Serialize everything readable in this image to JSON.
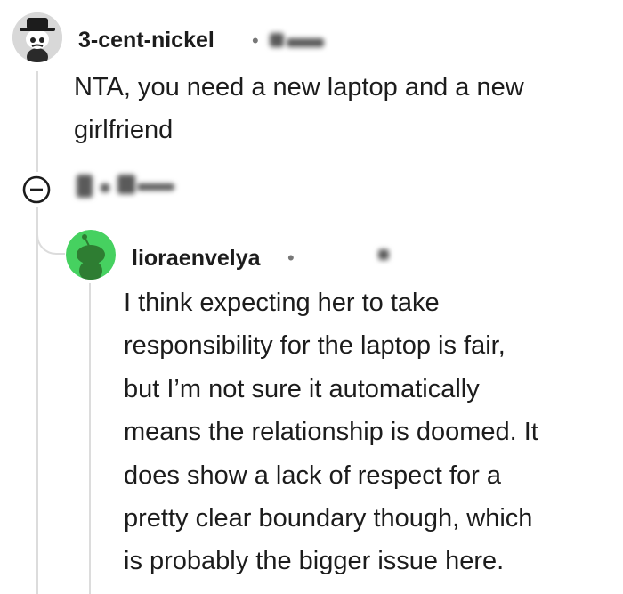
{
  "parent_comment": {
    "username": "3-cent-nickel",
    "separator": "•",
    "text_line1": "NTA, you need a new laptop and a new",
    "text_line2": "girlfriend"
  },
  "reply_comment": {
    "username": "lioraenvelya",
    "separator": "•",
    "lines": [
      "I think expecting her to take",
      "responsibility for the laptop is fair,",
      "but I’m not sure it automatically",
      "means the relationship is doomed. It",
      "does show a lack of respect for a",
      "pretty clear boundary though, which",
      "is probably the bigger issue here."
    ]
  },
  "icons": {
    "parent_avatar": "snoo-detective-avatar",
    "reply_avatar": "snoo-green-avatar",
    "collapse": "minus-circle-icon"
  },
  "colors": {
    "reply_avatar_bg": "#46d160",
    "reply_snoo": "#2e7d32",
    "thread_line": "#dcdcdc"
  }
}
